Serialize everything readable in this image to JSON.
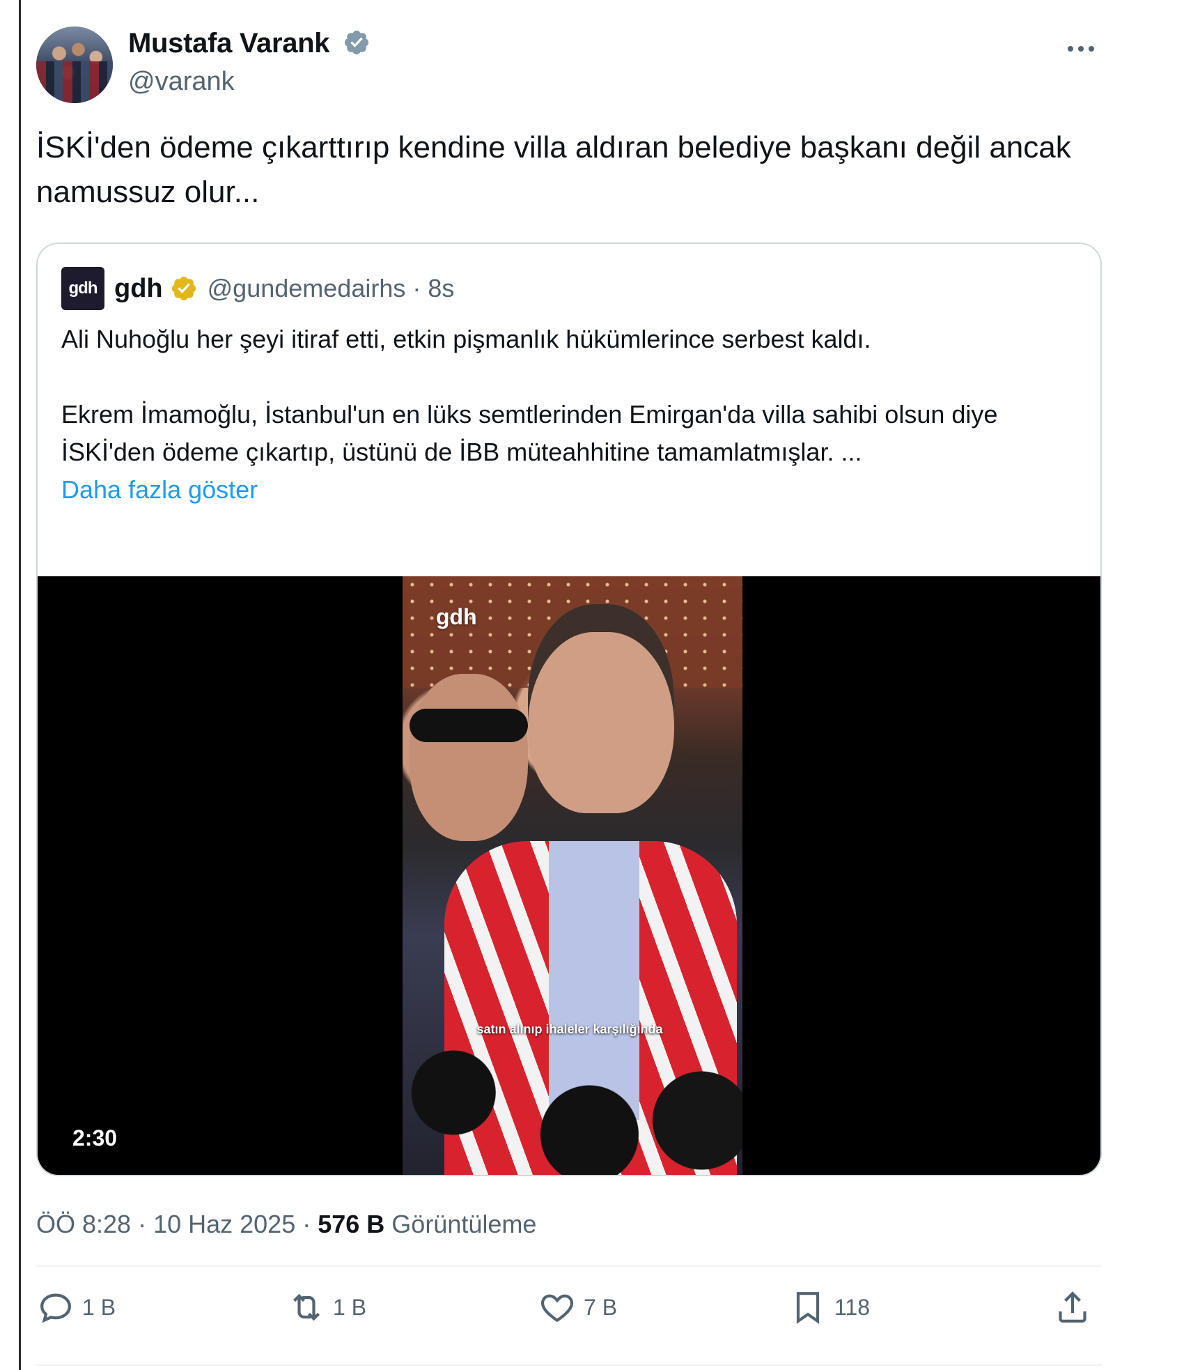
{
  "author": {
    "name": "Mustafa Varank",
    "handle": "@varank"
  },
  "tweet": {
    "text": "İSKİ'den ödeme çıkarttırıp kendine villa aldıran belediye başkanı değil ancak namussuz olur..."
  },
  "quote": {
    "logo_text": "gdh",
    "name": "gdh",
    "handle_time": "@gundemedairhs · 8s",
    "paragraph1": "Ali Nuhoğlu her şeyi itiraf etti, etkin pişmanlık hükümlerince serbest kaldı.",
    "paragraph2": "Ekrem İmamoğlu, İstanbul'un en lüks semtlerinden Emirgan'da villa sahibi olsun diye İSKİ'den ödeme çıkartıp, üstünü de İBB müteahhitine tamamlatmışlar. ...",
    "show_more": "Daha fazla göster",
    "video": {
      "duration": "2:30",
      "watermark": "gdh",
      "caption": "satın alınıp ihaleler karşılığında"
    }
  },
  "meta": {
    "time_date": "ÖÖ 8:28 · 10 Haz 2025 · ",
    "views_count": "576 B",
    "views_label": " Görüntüleme"
  },
  "actions": {
    "reply": "1 B",
    "retweet": "1 B",
    "like": "7 B",
    "bookmark": "118"
  },
  "colors": {
    "accent": "#1d9bf0",
    "text": "#0f1419",
    "muted": "#536471",
    "verified_gold": "#e2b719"
  }
}
